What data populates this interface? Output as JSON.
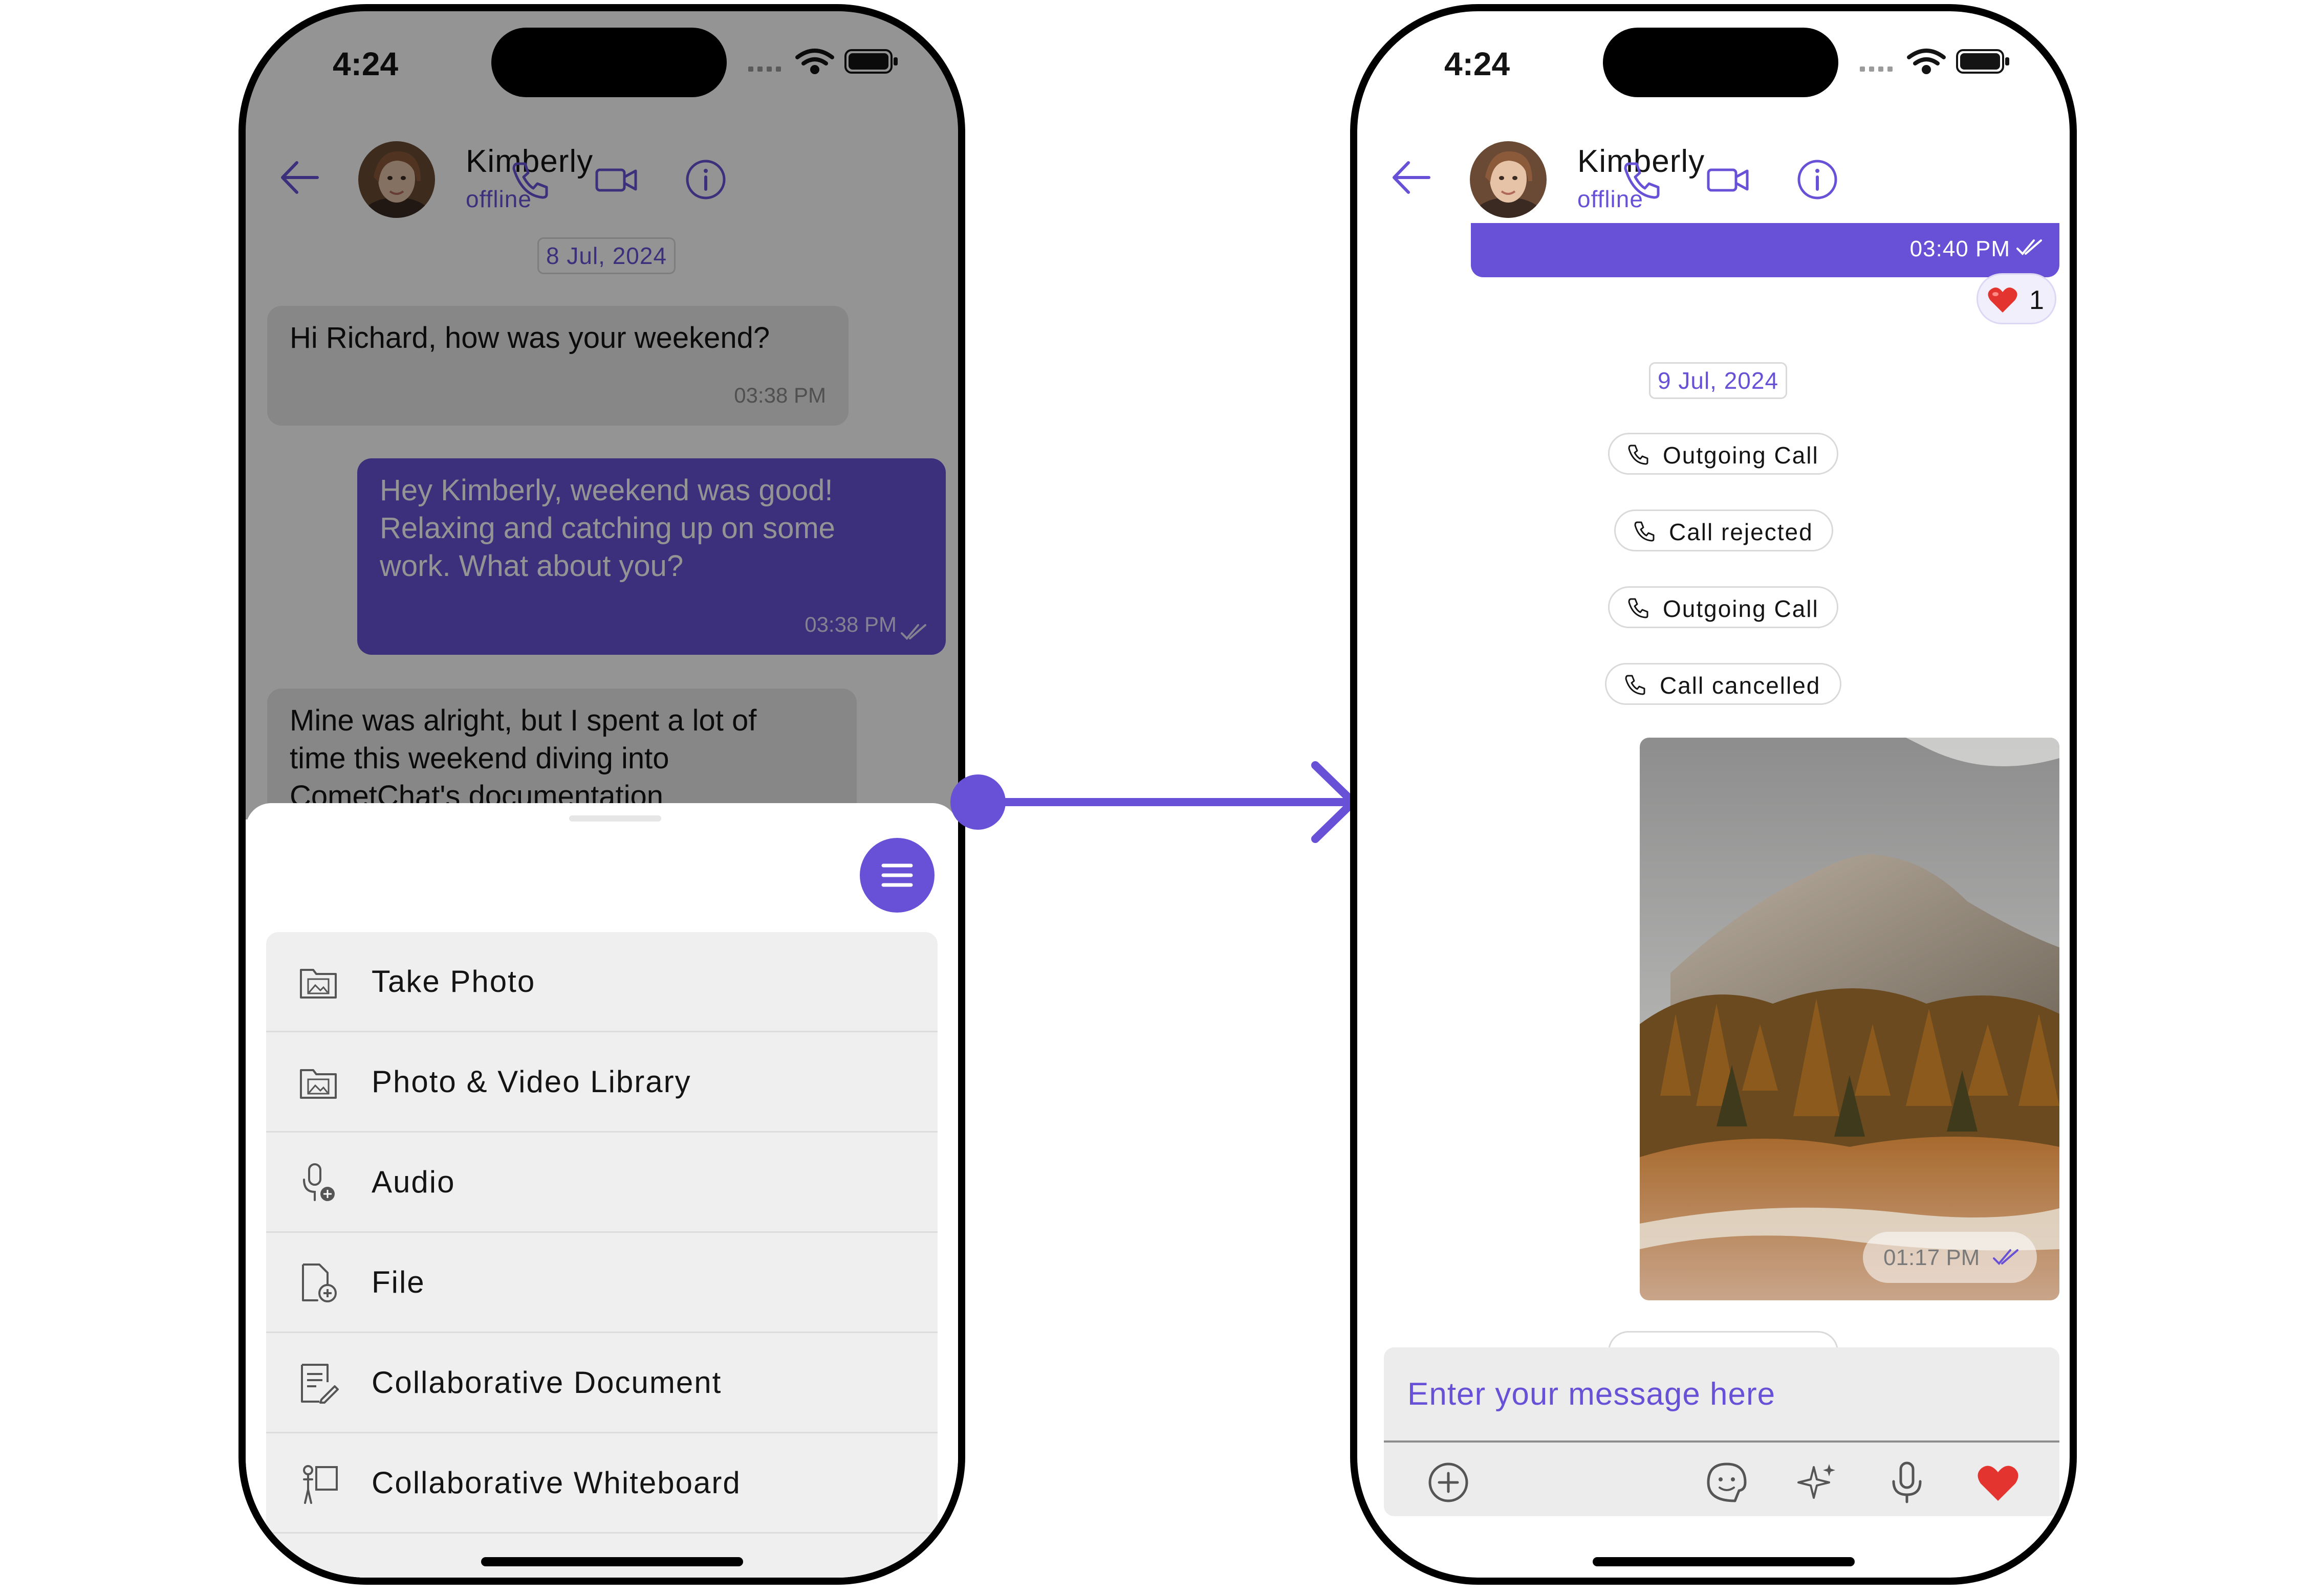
{
  "colors": {
    "accent": "#6851D6",
    "outgoing_bubble_dimmed": "#41318A",
    "incoming_bubble": "#E8E8E8",
    "reaction": "#E3342F"
  },
  "status_bar": {
    "time": "4:24",
    "icons": [
      "signal-icon",
      "wifi-icon",
      "battery-icon"
    ]
  },
  "header": {
    "name": "Kimberly",
    "status": "offline",
    "icons": [
      "back-arrow-icon",
      "phone-icon",
      "video-call-icon",
      "info-icon"
    ]
  },
  "left_screen": {
    "date_separator": "8 Jul, 2024",
    "messages": [
      {
        "text": "Hi Richard, how was your weekend?",
        "time": "03:38 PM",
        "direction": "incoming"
      },
      {
        "line1": "Hey Kimberly, weekend was good!",
        "line2": "Relaxing and catching up on some",
        "line3": "work.  What about you?",
        "time": "03:38 PM",
        "direction": "outgoing",
        "receipt": "read-double-check-icon"
      },
      {
        "line1": "Mine was alright, but I spent a lot of",
        "line2": "time this weekend diving into",
        "line3": "CometChat's documentation",
        "direction": "incoming"
      }
    ],
    "attachment_menu": {
      "close_icon": "menu-lines-icon",
      "items": [
        {
          "label": "Take Photo",
          "icon": "photo-folder-icon"
        },
        {
          "label": "Photo & Video Library",
          "icon": "photo-folder-icon"
        },
        {
          "label": "Audio",
          "icon": "microphone-add-icon"
        },
        {
          "label": "File",
          "icon": "file-add-icon"
        },
        {
          "label": "Collaborative Document",
          "icon": "document-edit-icon"
        },
        {
          "label": "Collaborative Whiteboard",
          "icon": "whiteboard-icon"
        }
      ]
    }
  },
  "right_screen": {
    "top_message_time": "03:40 PM",
    "reaction": {
      "emoji": "❤️",
      "count": "1"
    },
    "date_separator": "9 Jul, 2024",
    "call_logs": [
      "Outgoing Call",
      "Call rejected",
      "Outgoing Call",
      "Call cancelled"
    ],
    "image_message": {
      "time": "01:17 PM",
      "subject": "mountain landscape photo"
    },
    "composer": {
      "placeholder": "Enter your message here",
      "icons": [
        "add-attachment-icon",
        "sticker-icon",
        "ai-sparkle-icon",
        "microphone-icon",
        "heart-icon"
      ]
    }
  }
}
